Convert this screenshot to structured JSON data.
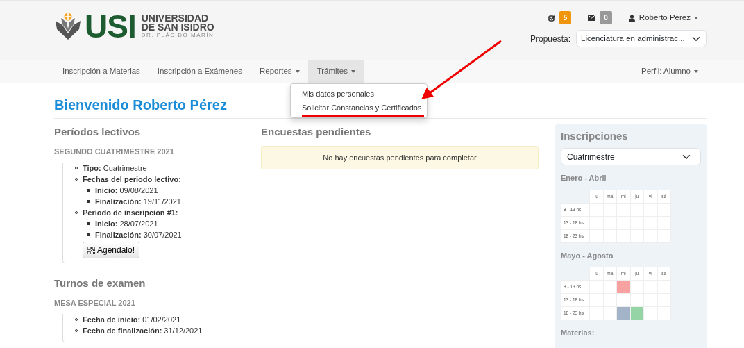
{
  "header": {
    "logo": {
      "acronym": "USI",
      "name_line_1": "UNIVERSIDAD",
      "name_line_2": "DE SAN ISIDRO",
      "name_line_3": "DR. PLÁCIDO MARÍN"
    },
    "tasks_badge": "5",
    "messages_badge": "0",
    "user": "Roberto Pérez",
    "proposal_label": "Propuesta:",
    "proposal_value": "Licenciatura en administrac..."
  },
  "nav": {
    "items": [
      {
        "label": "Inscripción a Materias",
        "dropdown": false,
        "selected": false
      },
      {
        "label": "Inscripción a Exámenes",
        "dropdown": false,
        "selected": false
      },
      {
        "label": "Reportes",
        "dropdown": true,
        "selected": false
      },
      {
        "label": "Trámites",
        "dropdown": true,
        "selected": true
      }
    ],
    "profile": "Perfil: Alumno",
    "menu": [
      {
        "label": "Mis datos personales",
        "highlighted": false
      },
      {
        "label": "Solicitar Constancias y Certificados",
        "highlighted": true
      }
    ]
  },
  "welcome": "Bienvenido Roberto Pérez",
  "periods": {
    "title": "Períodos lectivos",
    "subtitle": "SEGUNDO CUATRIMESTRE 2021",
    "items": [
      {
        "text": "**Tipo:** Cuatrimestre"
      },
      {
        "text": "**Fechas del periodo lectivo:**",
        "children": [
          {
            "text": "**Inicio:** 09/08/2021"
          },
          {
            "text": "**Finalización:** 19/11/2021"
          }
        ]
      },
      {
        "text": "**Período de inscripción #1:**",
        "children": [
          {
            "text": "**Inicio:** 28/07/2021"
          },
          {
            "text": "**Finalización:** 30/07/2021"
          }
        ]
      }
    ],
    "button": "Agendalo!"
  },
  "exams": {
    "title": "Turnos de examen",
    "subtitle": "MESA ESPECIAL 2021",
    "items": [
      {
        "text": "**Fecha de inicio:** 01/02/2021"
      },
      {
        "text": "**Fecha de finalización:** 31/12/2021"
      }
    ]
  },
  "surveys": {
    "title": "Encuestas pendientes",
    "message": "No hay encuestas pendientes para completar"
  },
  "sidebar": {
    "title": "Inscripciones",
    "select": "Cuatrimestre",
    "calendars": [
      {
        "title": "Enero - Abril",
        "days": [
          "lu",
          "ma",
          "mi",
          "ju",
          "vi",
          "sá"
        ],
        "rows": [
          {
            "label": "8 - 13 hs",
            "cells": [
              {
                "filled": false
              },
              {
                "filled": false
              },
              {
                "filled": false
              },
              {
                "filled": false
              },
              {
                "filled": false
              },
              {
                "filled": false
              }
            ]
          },
          {
            "label": "13 - 18 hs",
            "cells": [
              {
                "filled": false
              },
              {
                "filled": false
              },
              {
                "filled": false
              },
              {
                "filled": false
              },
              {
                "filled": false
              },
              {
                "filled": false
              }
            ]
          },
          {
            "label": "18 - 23 hs",
            "cells": [
              {
                "filled": false
              },
              {
                "filled": false
              },
              {
                "filled": false
              },
              {
                "filled": false
              },
              {
                "filled": false
              },
              {
                "filled": false
              }
            ]
          }
        ]
      },
      {
        "title": "Mayo - Agosto",
        "days": [
          "lu",
          "ma",
          "mi",
          "ju",
          "vi",
          "sá"
        ],
        "rows": [
          {
            "label": "8 - 13 hs",
            "cells": [
              {
                "filled": false
              },
              {
                "filled": false
              },
              {
                "filled": true,
                "color": "#f7a1a1"
              },
              {
                "filled": false
              },
              {
                "filled": false
              },
              {
                "filled": false
              }
            ]
          },
          {
            "label": "13 - 18 hs",
            "cells": [
              {
                "filled": false
              },
              {
                "filled": false
              },
              {
                "filled": false
              },
              {
                "filled": false
              },
              {
                "filled": false
              },
              {
                "filled": false
              }
            ]
          },
          {
            "label": "18 - 23 hs",
            "cells": [
              {
                "filled": false
              },
              {
                "filled": false
              },
              {
                "filled": true,
                "color": "#a3b3c8"
              },
              {
                "filled": true,
                "color": "#95d5a5"
              },
              {
                "filled": false
              },
              {
                "filled": false
              }
            ]
          }
        ]
      }
    ],
    "materias": "Materias:"
  }
}
